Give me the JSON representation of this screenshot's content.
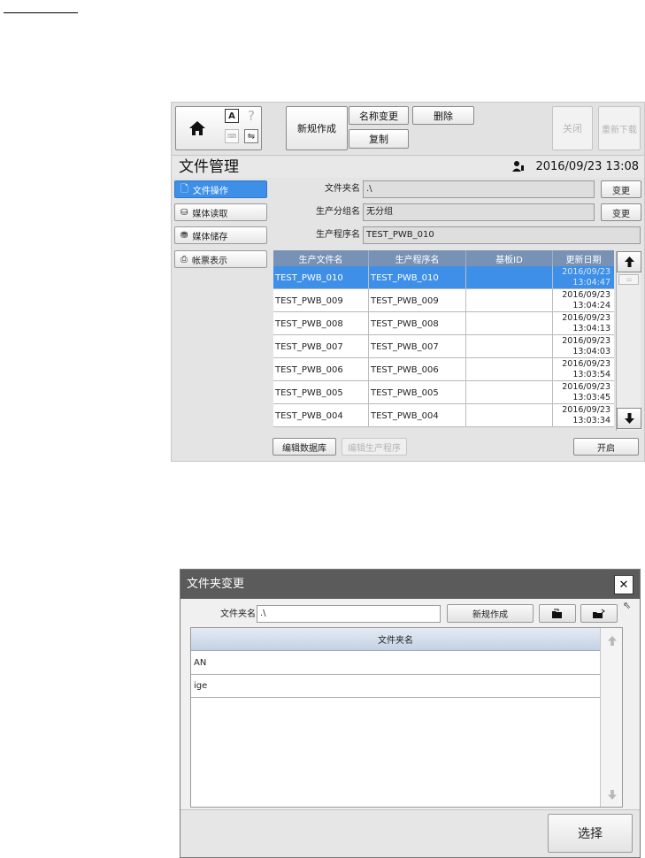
{
  "window1": {
    "toolbar": {
      "new_label": "新规作成",
      "rename_label": "名称变更",
      "delete_label": "删除",
      "copy_label": "复制",
      "close_label": "关闭",
      "reload_label": "重新下载"
    },
    "header": {
      "title": "文件管理",
      "datetime": "2016/09/23 13:08"
    },
    "sidebar": {
      "items": [
        {
          "label": "文件操作"
        },
        {
          "label": "媒体读取"
        },
        {
          "label": "媒体储存"
        },
        {
          "label": "帐票表示"
        }
      ]
    },
    "form": {
      "folder_label": "文件夹名",
      "folder_value": ".\\",
      "group_label": "生产分组名",
      "group_value": "无分组",
      "program_label": "生产程序名",
      "program_value": "TEST_PWB_010",
      "change_label": "变更"
    },
    "table": {
      "columns": [
        "生产文件名",
        "生产程序名",
        "基板ID",
        "更新日期"
      ],
      "rows": [
        {
          "file": "TEST_PWB_010",
          "program": "TEST_PWB_010",
          "board_id": "",
          "date": "2016/09/23",
          "time": "13:04:47"
        },
        {
          "file": "TEST_PWB_009",
          "program": "TEST_PWB_009",
          "board_id": "",
          "date": "2016/09/23",
          "time": "13:04:24"
        },
        {
          "file": "TEST_PWB_008",
          "program": "TEST_PWB_008",
          "board_id": "",
          "date": "2016/09/23",
          "time": "13:04:13"
        },
        {
          "file": "TEST_PWB_007",
          "program": "TEST_PWB_007",
          "board_id": "",
          "date": "2016/09/23",
          "time": "13:04:03"
        },
        {
          "file": "TEST_PWB_006",
          "program": "TEST_PWB_006",
          "board_id": "",
          "date": "2016/09/23",
          "time": "13:03:54"
        },
        {
          "file": "TEST_PWB_005",
          "program": "TEST_PWB_005",
          "board_id": "",
          "date": "2016/09/23",
          "time": "13:03:45"
        },
        {
          "file": "TEST_PWB_004",
          "program": "TEST_PWB_004",
          "board_id": "",
          "date": "2016/09/23",
          "time": "13:03:34"
        }
      ],
      "selected_row": 0
    },
    "bottom": {
      "edit_db_label": "编辑数据库",
      "edit_program_label": "编辑生产程序",
      "open_label": "开启"
    }
  },
  "window2": {
    "title": "文件夹变更",
    "folder_label": "文件夹名",
    "folder_value": ".\\",
    "new_label": "新规作成",
    "list_header": "文件夹名",
    "items": [
      "AN",
      "ige"
    ],
    "select_label": "选择"
  },
  "colors": {
    "accent": "#3d8fe8",
    "grid_header": "#7892b6",
    "dialog_title": "#5b5b5b"
  }
}
